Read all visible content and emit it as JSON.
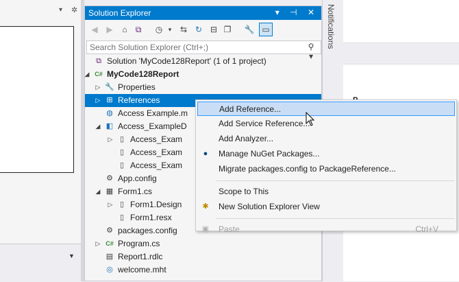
{
  "solution_explorer": {
    "title": "Solution Explorer",
    "title_buttons": "▾ ⊣ ✕",
    "search_placeholder": "Search Solution Explorer (Ctrl+;)",
    "tree": [
      {
        "label": "Solution 'MyCode128Report' (1 of 1 project)",
        "icon": "solution-icon",
        "glyph": "⧉",
        "color": "#68217a"
      },
      {
        "label": "MyCode128Report",
        "icon": "csharp-project-icon",
        "glyph": "C#",
        "color": "#388a34",
        "expander": "◢"
      },
      {
        "label": "Properties",
        "icon": "wrench-icon",
        "glyph": "🔧",
        "color": "#424242",
        "expander": "▷"
      },
      {
        "label": "References",
        "icon": "references-icon",
        "glyph": "⊞",
        "color": "#ffffff",
        "expander": "▷"
      },
      {
        "label": "Access Example.m",
        "icon": "database-icon",
        "glyph": "◍",
        "color": "#1e73b8"
      },
      {
        "label": "Access_ExampleD",
        "icon": "dataset-icon",
        "glyph": "◧",
        "color": "#1e73b8",
        "expander": "◢"
      },
      {
        "label": "Access_Exam",
        "icon": "file-icon",
        "glyph": "▯",
        "color": "#424242",
        "expander": "▷"
      },
      {
        "label": "Access_Exam",
        "icon": "file-icon",
        "glyph": "▯",
        "color": "#424242"
      },
      {
        "label": "Access_Exam",
        "icon": "file-icon",
        "glyph": "▯",
        "color": "#424242"
      },
      {
        "label": "App.config",
        "icon": "config-icon",
        "glyph": "⚙",
        "color": "#424242"
      },
      {
        "label": "Form1.cs",
        "icon": "form-icon",
        "glyph": "▦",
        "color": "#424242",
        "expander": "◢"
      },
      {
        "label": "Form1.Design",
        "icon": "file-icon",
        "glyph": "▯",
        "color": "#424242",
        "expander": "▷"
      },
      {
        "label": "Form1.resx",
        "icon": "file-icon",
        "glyph": "▯",
        "color": "#424242"
      },
      {
        "label": "packages.config",
        "icon": "config-icon",
        "glyph": "⚙",
        "color": "#424242"
      },
      {
        "label": "Program.cs",
        "icon": "csharp-file-icon",
        "glyph": "C#",
        "color": "#388a34",
        "expander": "▷"
      },
      {
        "label": "Report1.rdlc",
        "icon": "report-icon",
        "glyph": "▤",
        "color": "#424242"
      },
      {
        "label": "welcome.mht",
        "icon": "web-icon",
        "glyph": "◎",
        "color": "#1e73b8"
      }
    ]
  },
  "notifications_label": "Notifications",
  "right_header": "P",
  "context_menu": {
    "items": [
      {
        "label": "Add Reference...",
        "shortcut": "",
        "icon": "",
        "highlight": true,
        "disabled": false
      },
      {
        "label": "Add Service Reference...",
        "shortcut": "",
        "icon": "",
        "highlight": false,
        "disabled": false
      },
      {
        "label": "Add Analyzer...",
        "shortcut": "",
        "icon": "",
        "highlight": false,
        "disabled": false
      },
      {
        "label": "Manage NuGet Packages...",
        "shortcut": "",
        "icon": "nuget-icon",
        "highlight": false,
        "disabled": false
      },
      {
        "label": "Migrate packages.config to PackageReference...",
        "shortcut": "",
        "icon": "",
        "highlight": false,
        "disabled": false
      },
      {
        "sep": true
      },
      {
        "label": "Scope to This",
        "shortcut": "",
        "icon": "",
        "highlight": false,
        "disabled": false
      },
      {
        "label": "New Solution Explorer View",
        "shortcut": "",
        "icon": "new-view-icon",
        "highlight": false,
        "disabled": false
      },
      {
        "sep": true
      },
      {
        "label": "Paste",
        "shortcut": "Ctrl+V",
        "icon": "paste-icon",
        "highlight": false,
        "disabled": true
      }
    ]
  }
}
